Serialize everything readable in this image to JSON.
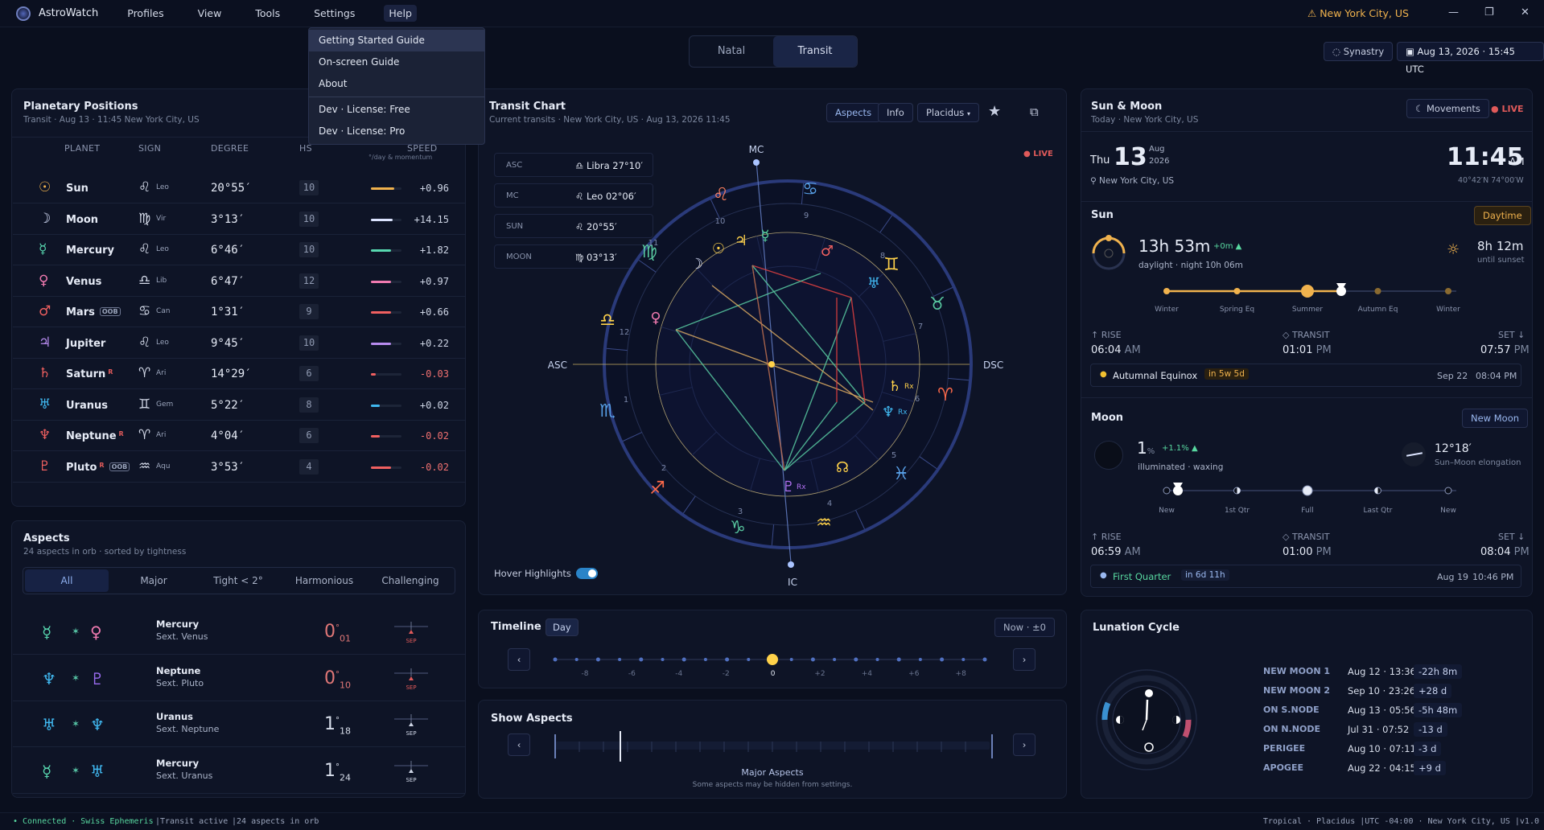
{
  "app": {
    "title": "AstroWatch",
    "menu": [
      "Profiles",
      "View",
      "Tools",
      "Settings",
      "Help"
    ],
    "location": "New York City, US"
  },
  "help_menu": {
    "items": [
      "Getting Started Guide",
      "On-screen Guide",
      "About"
    ],
    "dev_items": [
      "Dev · License: Free",
      "Dev · License: Pro"
    ]
  },
  "mode_tabs": {
    "natal": "Natal",
    "transit": "Transit"
  },
  "header_right": {
    "synastry": "Synastry",
    "datetime": "Aug 13, 2026 · 15:45 UTC"
  },
  "planets": {
    "title": "Planetary Positions",
    "subtitle": "Transit · Aug 13 · 11:45 New York City, US",
    "headers": {
      "planet": "PLANET",
      "sign": "SIGN",
      "degree": "DEGREE",
      "hs": "HS",
      "speed": "SPEED",
      "speed_sub": "°/day & momentum"
    },
    "rows": [
      {
        "glyph": "☉",
        "name": "Sun",
        "sign": "♌",
        "sign_abbr": "Leo",
        "degree": "20°55′",
        "hs": "10",
        "speed": "+0.96",
        "color": "#f0b24d",
        "momentum": 0.75
      },
      {
        "glyph": "☽",
        "name": "Moon",
        "sign": "♍",
        "sign_abbr": "Vir",
        "degree": "3°13′",
        "hs": "10",
        "speed": "+14.15",
        "color": "#dce4ff",
        "momentum": 0.72
      },
      {
        "glyph": "☿",
        "name": "Mercury",
        "sign": "♌",
        "sign_abbr": "Leo",
        "degree": "6°46′",
        "hs": "10",
        "speed": "+1.82",
        "color": "#58d8b0",
        "momentum": 0.65
      },
      {
        "glyph": "♀",
        "name": "Venus",
        "sign": "♎",
        "sign_abbr": "Lib",
        "degree": "6°47′",
        "hs": "12",
        "speed": "+0.97",
        "color": "#f07ab0",
        "momentum": 0.65
      },
      {
        "glyph": "♂",
        "name": "Mars",
        "tag": "OOB",
        "sign": "♋",
        "sign_abbr": "Can",
        "degree": "1°31′",
        "hs": "9",
        "speed": "+0.66",
        "color": "#f06060",
        "momentum": 0.65
      },
      {
        "glyph": "♃",
        "name": "Jupiter",
        "sign": "♌",
        "sign_abbr": "Leo",
        "degree": "9°45′",
        "hs": "10",
        "speed": "+0.22",
        "color": "#b88cf0",
        "momentum": 0.65
      },
      {
        "glyph": "♄",
        "name": "Saturn",
        "rx": "R",
        "sign": "♈",
        "sign_abbr": "Ari",
        "degree": "14°29′",
        "hs": "6",
        "speed": "-0.03",
        "color": "#f06060",
        "momentum": 0.15
      },
      {
        "glyph": "♅",
        "name": "Uranus",
        "sign": "♊",
        "sign_abbr": "Gem",
        "degree": "5°22′",
        "hs": "8",
        "speed": "+0.02",
        "color": "#40b8f0",
        "momentum": 0.3
      },
      {
        "glyph": "♆",
        "name": "Neptune",
        "rx": "R",
        "sign": "♈",
        "sign_abbr": "Ari",
        "degree": "4°04′",
        "hs": "6",
        "speed": "-0.02",
        "color": "#f06060",
        "momentum": 0.3
      },
      {
        "glyph": "♇",
        "name": "Pluto",
        "rx": "R",
        "tag": "OOB",
        "sign": "♒",
        "sign_abbr": "Aqu",
        "degree": "3°53′",
        "hs": "4",
        "speed": "-0.02",
        "color": "#f06060",
        "momentum": 0.65
      }
    ]
  },
  "aspects": {
    "title": "Aspects",
    "subtitle": "24 aspects in orb · sorted by tightness",
    "filters": [
      "All",
      "Major",
      "Tight < 2°",
      "Harmonious",
      "Challenging"
    ],
    "rows": [
      {
        "g1": "☿",
        "c1": "#58d8b0",
        "g2": "♀",
        "c2": "#f07ab0",
        "name": "Mercury",
        "type": "Sext.",
        "target": "Venus",
        "orb_deg": "0",
        "orb_min": "01",
        "sep": "SEP"
      },
      {
        "g1": "♆",
        "c1": "#40b8f0",
        "g2": "♇",
        "c2": "#9a6cf0",
        "name": "Neptune",
        "type": "Sext.",
        "target": "Pluto",
        "orb_deg": "0",
        "orb_min": "10",
        "sep": "SEP"
      },
      {
        "g1": "♅",
        "c1": "#40b8f0",
        "g2": "♆",
        "c2": "#40b8f0",
        "name": "Uranus",
        "type": "Sext.",
        "target": "Neptune",
        "orb_deg": "1",
        "orb_min": "18",
        "sep": "SEP"
      },
      {
        "g1": "☿",
        "c1": "#58d8b0",
        "g2": "♅",
        "c2": "#40b8f0",
        "name": "Mercury",
        "type": "Sext.",
        "target": "Uranus",
        "orb_deg": "1",
        "orb_min": "24",
        "sep": "SEP"
      }
    ]
  },
  "chart": {
    "title": "Transit Chart",
    "subtitle": "Current transits · New York City, US · Aug 13, 2026 11:45",
    "buttons": {
      "aspects": "Aspects",
      "info": "Info",
      "house": "Placidus"
    },
    "live": "LIVE",
    "angles": [
      {
        "label": "ASC",
        "glyph": "♎",
        "value": "Libra  27°10′"
      },
      {
        "label": "MC",
        "glyph": "♌",
        "value": "Leo  02°06′"
      },
      {
        "label": "SUN",
        "glyph": "♌",
        "value": "20°55′"
      },
      {
        "label": "MOON",
        "glyph": "♍",
        "value": "03°13′"
      }
    ],
    "axis": {
      "mc": "MC",
      "ic": "IC",
      "asc": "ASC",
      "dsc": "DSC"
    },
    "rx": "Rx",
    "hover": "Hover Highlights"
  },
  "timeline": {
    "title": "Timeline",
    "unit": "Day",
    "now": "Now · ±0",
    "ticks": [
      "-8",
      "-6",
      "-4",
      "-2",
      "0",
      "+2",
      "+4",
      "+6",
      "+8"
    ]
  },
  "show_aspects": {
    "title": "Show Aspects",
    "label": "Major Aspects",
    "note": "Some aspects may be hidden from settings."
  },
  "sunmoon": {
    "title": "Sun & Moon",
    "subtitle": "Today · New York City, US",
    "movements": "Movements",
    "live": "LIVE",
    "weekday": "Thu",
    "day": "13",
    "month": "Aug",
    "year": "2026",
    "time": "11:45",
    "ampm": "AM",
    "coords": "40°42′N 74°00′W",
    "place": "New York City, US",
    "sun": {
      "title": "Sun",
      "badge": "Daytime",
      "daylight": "13h 53m",
      "delta": "+0m ▲",
      "sub": "daylight · night 10h 06m",
      "until": "8h 12m",
      "until_sub": "until sunset",
      "seasons": [
        "Winter",
        "Spring Eq",
        "Summer",
        "Autumn Eq",
        "Winter"
      ],
      "rise_l": "↑ RISE",
      "rise": "06:04",
      "rise_ap": "AM",
      "transit_l": "◇ TRANSIT",
      "transit": "01:01",
      "transit_ap": "PM",
      "set_l": "SET ↓",
      "set": "07:57",
      "set_ap": "PM",
      "event": "Autumnal Equinox",
      "event_in": "in 5w 5d",
      "event_date": "Sep 22",
      "event_time": "08:04 PM"
    },
    "moon": {
      "title": "Moon",
      "badge": "New Moon",
      "pct": "1",
      "pct_unit": "%",
      "delta": "+1.1% ▲",
      "sub": "illuminated · waxing",
      "elong": "12°18′",
      "elong_sub": "Sun–Moon elongation",
      "phases": [
        "New",
        "1st Qtr",
        "Full",
        "Last Qtr",
        "New"
      ],
      "rise_l": "↑ RISE",
      "rise": "06:59",
      "rise_ap": "AM",
      "transit_l": "◇ TRANSIT",
      "transit": "01:00",
      "transit_ap": "PM",
      "set_l": "SET ↓",
      "set": "08:04",
      "set_ap": "PM",
      "event": "First Quarter",
      "event_in": "in 6d 11h",
      "event_date": "Aug 19",
      "event_time": "10:46 PM"
    }
  },
  "lunation": {
    "title": "Lunation Cycle",
    "rows": [
      {
        "k": "NEW MOON 1",
        "d": "Aug 12 · 13:36",
        "b": "-22h 8m"
      },
      {
        "k": "NEW MOON 2",
        "d": "Sep 10 · 23:26",
        "b": "+28 d"
      },
      {
        "k": "ON S.NODE",
        "d": "Aug 13 · 05:56",
        "b": "-5h 48m"
      },
      {
        "k": "ON N.NODE",
        "d": "Jul 31 · 07:52",
        "b": "-13 d"
      },
      {
        "k": "PERIGEE",
        "d": "Aug 10 · 07:11",
        "b": "-3 d"
      },
      {
        "k": "APOGEE",
        "d": "Aug 22 · 04:15",
        "b": "+9 d"
      }
    ]
  },
  "status": {
    "left": [
      "• Connected · Swiss Ephemeris",
      "|Transit active",
      "|24 aspects in orb"
    ],
    "right": "Tropical · Placidus  |UTC -04:00 · New York City, US  |v1.0"
  }
}
